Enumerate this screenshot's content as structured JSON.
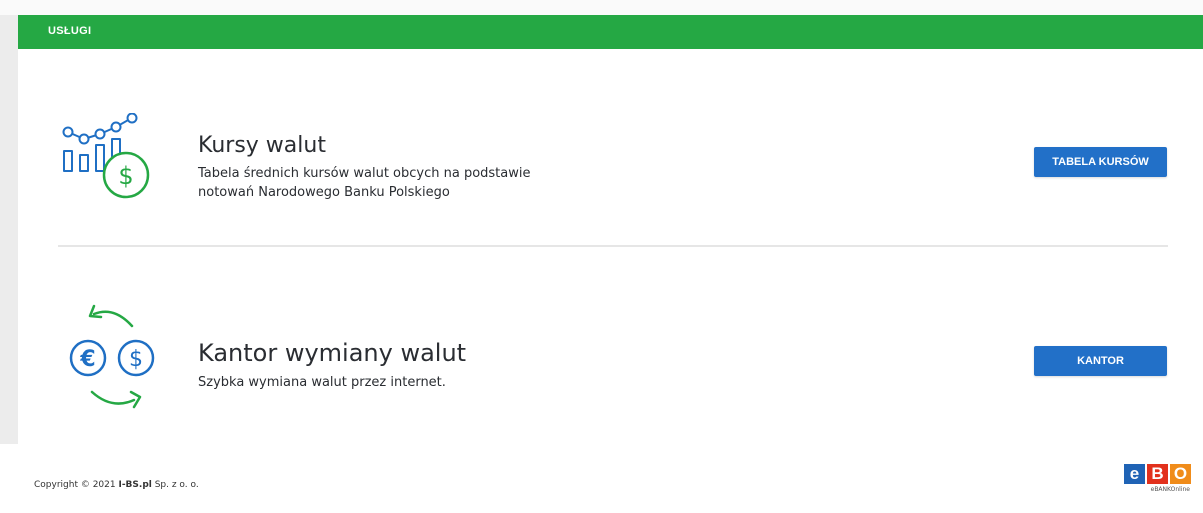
{
  "header": {
    "title": "USŁUGI"
  },
  "services": [
    {
      "title": "Kursy walut",
      "description_line1": "Tabela średnich kursów walut obcych na podstawie",
      "description_line2": "notowań Narodowego Banku Polskiego",
      "button_label": "TABELA KURSÓW",
      "icon": "chart-dollar-icon"
    },
    {
      "title": "Kantor wymiany walut",
      "description": "Szybka wymiana walut przez internet.",
      "button_label": "KANTOR",
      "icon": "currency-exchange-icon"
    }
  ],
  "footer": {
    "copyright_prefix": "Copyright © 2021 ",
    "copyright_company": "I-BS.pl",
    "copyright_suffix": " Sp. z o. o.",
    "logo_letters": [
      "e",
      "B",
      "O"
    ],
    "logo_caption": "eBANKOnline"
  },
  "colors": {
    "accent_green": "#25a844",
    "button_blue": "#2270c8",
    "icon_blue": "#1f6fc4",
    "logo_e": "#1f63b5",
    "logo_b": "#e2311d",
    "logo_o": "#f08c1a"
  }
}
